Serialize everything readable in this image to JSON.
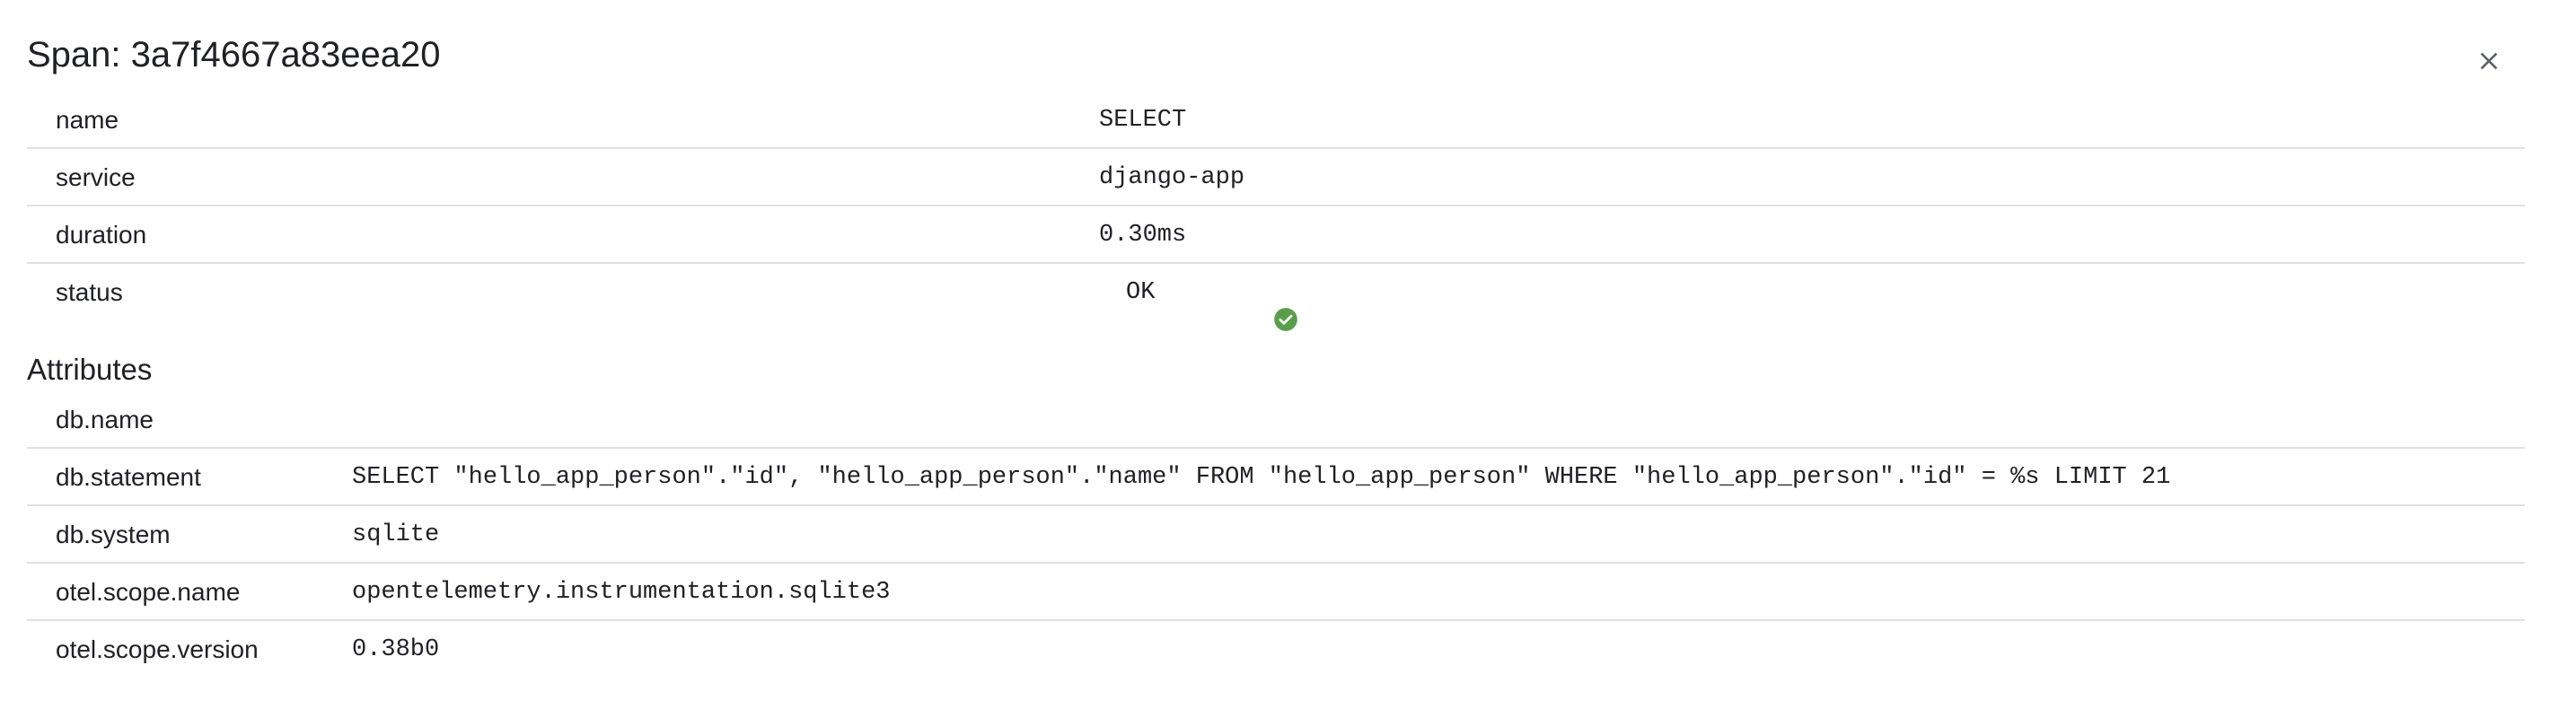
{
  "dialog": {
    "title": "Span: 3a7f4667a83eea20",
    "close_icon": "close-icon"
  },
  "span": {
    "rows": [
      {
        "key": "name",
        "value": "SELECT"
      },
      {
        "key": "service",
        "value": "django-app"
      },
      {
        "key": "duration",
        "value": "0.30ms"
      },
      {
        "key": "status",
        "value": "OK",
        "icon": "check-circle-icon",
        "icon_color": "#5a9e4b"
      }
    ]
  },
  "attributes": {
    "title": "Attributes",
    "rows": [
      {
        "key": "db.name",
        "value": ""
      },
      {
        "key": "db.statement",
        "value": "SELECT \"hello_app_person\".\"id\", \"hello_app_person\".\"name\" FROM \"hello_app_person\" WHERE \"hello_app_person\".\"id\" = %s LIMIT 21"
      },
      {
        "key": "db.system",
        "value": "sqlite"
      },
      {
        "key": "otel.scope.name",
        "value": "opentelemetry.instrumentation.sqlite3"
      },
      {
        "key": "otel.scope.version",
        "value": "0.38b0"
      }
    ]
  },
  "colors": {
    "divider": "#e0e0e0",
    "text": "#202124",
    "close_icon": "#5f6368",
    "status_ok": "#5a9e4b"
  }
}
